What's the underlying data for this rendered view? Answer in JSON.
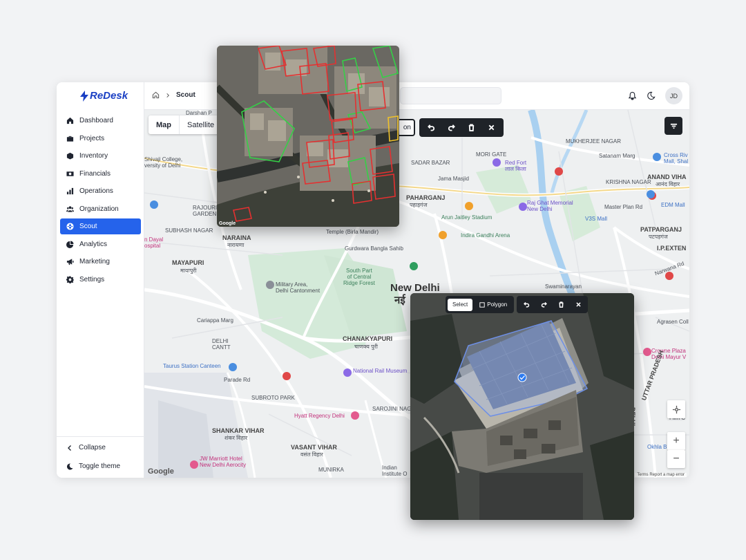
{
  "brand": {
    "name": "ReDesk",
    "color": "#1a3fc4"
  },
  "sidebar": {
    "items": [
      {
        "label": "Dashboard",
        "icon": "home-icon",
        "active": false
      },
      {
        "label": "Projects",
        "icon": "briefcase-icon",
        "active": false
      },
      {
        "label": "Inventory",
        "icon": "box-icon",
        "active": false
      },
      {
        "label": "Financials",
        "icon": "cash-icon",
        "active": false
      },
      {
        "label": "Operations",
        "icon": "bar-chart-icon",
        "active": false
      },
      {
        "label": "Organization",
        "icon": "users-icon",
        "active": false
      },
      {
        "label": "Scout",
        "icon": "globe-icon",
        "active": true
      },
      {
        "label": "Analytics",
        "icon": "pie-chart-icon",
        "active": false
      },
      {
        "label": "Marketing",
        "icon": "megaphone-icon",
        "active": false
      },
      {
        "label": "Settings",
        "icon": "gear-icon",
        "active": false
      }
    ],
    "collapse_label": "Collapse",
    "toggle_theme_label": "Toggle theme",
    "active_color": "#2563eb"
  },
  "header": {
    "breadcrumb_page": "Scout",
    "avatar_initials": "JD"
  },
  "map": {
    "toggle": {
      "map_label": "Map",
      "satellite_label": "Satellite",
      "selected": "Map"
    },
    "polygon_button_partial": "on",
    "attribution": "Google",
    "terms_text": "Terms   Report a map error",
    "labels": {
      "new_delhi": "New Delhi",
      "new_delhi_hi": "नई",
      "chanakyapuri": "CHANAKYAPURI",
      "chanakyapuri_hi": "चाणक्य पुरी",
      "paharganj": "PAHARGANJ",
      "paharganj_hi": "पहाड़गंज",
      "mayapuri": "MAYAPURI",
      "mayapuri_hi": "मायापुरी",
      "naraina": "NARAINA",
      "naraina_hi": "नारायणा",
      "shankar_vihar": "SHANKAR VIHAR",
      "shankar_vihar_hi": "शंकर विहार",
      "vasant_vihar": "VASANT VIHAR",
      "vasant_vihar_hi": "वसंत विहार",
      "patparganj": "PATPARGANJ",
      "patparganj_hi": "पटपड़गंज",
      "anand_vihar": "ANAND VIHA",
      "anand_vihar_hi": "आनंद विहार",
      "ip_extension": "I.P.EXTEN",
      "red_fort": "Red Fort",
      "red_fort_hi": "लाल किला",
      "raj_ghat": "Raj Ghat Memorial",
      "raj_ghat2": "New Delhi",
      "jama_masjid": "Jama Masjid",
      "arun_jaitley": "Arun Jaitley Stadium",
      "indira_gandhi": "Indira Gandhi Arena",
      "gurdwara": "Gurdwara Bangla Sahib",
      "birla_temple": "Temple (Birla Mandir)",
      "military_area": "Military Area,",
      "military_area2": "Delhi Cantonment",
      "south_ridge": "South Part\nof Central\nRidge Forest",
      "taurus": "Taurus Station Canteen",
      "national_rail": "National Rail Museum",
      "hyatt": "Hyatt Regency Delhi",
      "jw_marriott": "JW Marriott Hotel",
      "jw_marriott2": "New Delhi Aerocity",
      "swaminarayan": "Swaminarayan",
      "edm_mall": "EDM Mall",
      "v3s_mall": "V3S Mall",
      "master_plan": "Master Plan Rd",
      "crowne_plaza": "Crowne Plaza",
      "crowne_plaza2": "Delhi Mayur V",
      "cross_river": "Cross Riv",
      "cross_river2": "Mall, Shal",
      "agrasen": "Agrasen Coll",
      "okhla": "Okhla B",
      "film_city": "Film C",
      "uttar_pradesh": "UTTAR PRADESH",
      "delhi_vert": "DELHI",
      "shivaji": "Shivaji College,",
      "shivaji2": "versity of Delhi",
      "rajouri": "RAJOURI",
      "rajouri2": "GARDEN",
      "subhash": "SUBHASH NAGAR",
      "dayal": "n Dayal",
      "dayal2": "ospital",
      "mukherjee": "MUKHERJEE NAGAR",
      "krishna": "KRISHNA NAGAR",
      "satanam": "Satanam Marg",
      "sadar": "SADAR BAZAR",
      "mori_gate": "MORI GATE",
      "darshan": "Darshan P",
      "delhi_cantt": "DELHI",
      "delhi_cantt2": "CANTT",
      "subroto": "SUBROTO PARK",
      "parade": "Parade Rd",
      "cariappa": "Cariappa Marg",
      "sarojini": "SAROJINI NAGAR",
      "munirka": "MUNIRKA",
      "indian_inst": "Indian",
      "indian_inst2": "Institute O",
      "narwana": "Narwana Rd"
    }
  },
  "satellite_top": {
    "attribution": "Google"
  },
  "satellite_bottom": {
    "select_label": "Select",
    "polygon_label": "Polygon"
  }
}
